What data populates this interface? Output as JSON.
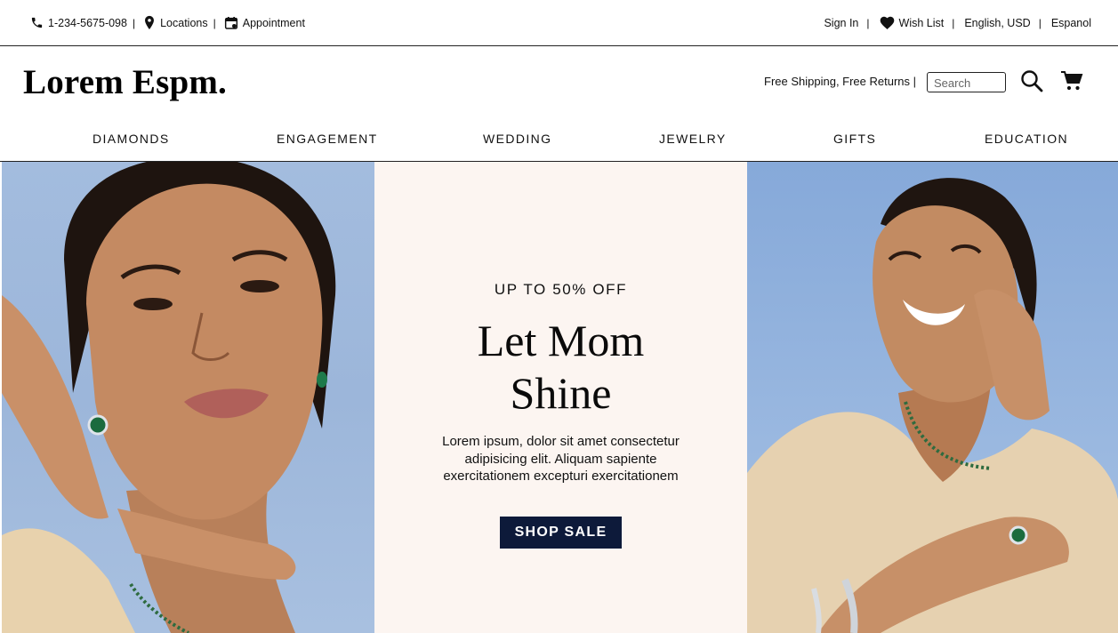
{
  "topbar": {
    "phone": "1-234-5675-098",
    "locations": "Locations",
    "appointment": "Appointment",
    "separator": "|",
    "sign_in": "Sign In",
    "wish_list": "Wish List",
    "currency": "English, USD",
    "language": "Espanol"
  },
  "header": {
    "logo": "Lorem Espm.",
    "promo": "Free Shipping, Free Returns |",
    "search_placeholder": "Search"
  },
  "nav": {
    "items": [
      {
        "label": "DIAMONDS"
      },
      {
        "label": "ENGAGEMENT"
      },
      {
        "label": "WEDDING"
      },
      {
        "label": "JEWELRY"
      },
      {
        "label": "GIFTS"
      },
      {
        "label": "EDUCATION"
      }
    ]
  },
  "hero": {
    "eyebrow": "UP TO 50% OFF",
    "headline_line1": "Let Mom",
    "headline_line2": "Shine",
    "body_line1": "Lorem ipsum, dolor sit amet consectetur",
    "body_line2": "adipisicing elit. Aliquam sapiente",
    "body_line3": "exercitationem excepturi exercitationem",
    "cta": "SHOP SALE"
  },
  "colors": {
    "cta_background": "#0d1a3a",
    "hero_center_background": "#fcf5f1",
    "sky_blue": "#9cb6da"
  },
  "icons": [
    "phone-icon",
    "location-pin-icon",
    "calendar-icon",
    "heart-icon",
    "search-icon",
    "cart-icon"
  ]
}
